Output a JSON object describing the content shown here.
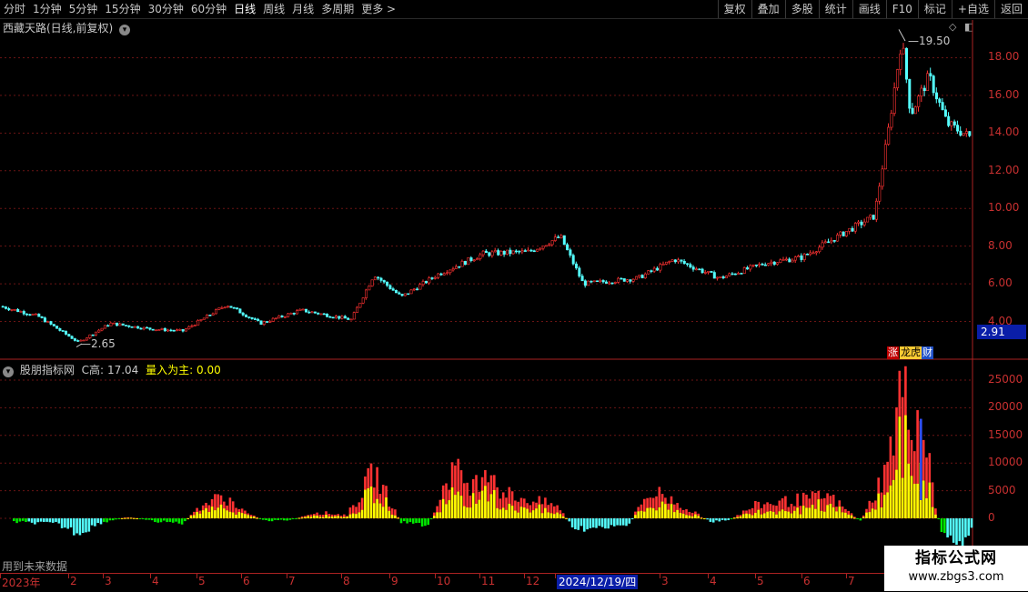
{
  "toolbar": {
    "periods": [
      "分时",
      "1分钟",
      "5分钟",
      "15分钟",
      "30分钟",
      "60分钟",
      "日线",
      "周线",
      "月线",
      "多周期",
      "更多 >"
    ],
    "active_period": "日线",
    "actions": [
      "复权",
      "叠加",
      "多股",
      "统计",
      "画线",
      "F10",
      "标记",
      "+自选",
      "返回"
    ]
  },
  "main_chart": {
    "title": "西藏天路(日线,前复权)",
    "high_label": "19.50",
    "low_label": "2.65",
    "axis_labels": [
      "18.00",
      "16.00",
      "14.00",
      "12.00",
      "10.00",
      "8.00",
      "6.00",
      "4.00"
    ],
    "current_price_tag": "2.91",
    "badges": [
      "涨",
      "龙虎",
      "财"
    ]
  },
  "indicator": {
    "name": "股朋指标网",
    "label1": "C高:",
    "value1": "17.04",
    "label2": "量入为主:",
    "value2": "0.00",
    "axis_labels": [
      "25000",
      "20000",
      "15000",
      "10000",
      "5000",
      "0"
    ],
    "footer_note": "用到未来数据"
  },
  "time_axis": {
    "labels": [
      "2023年",
      "2",
      "3",
      "4",
      "5",
      "6",
      "7",
      "8",
      "9",
      "10",
      "11",
      "12",
      "2024/12/19/四",
      "3",
      "4",
      "5",
      "6",
      "7"
    ]
  },
  "watermark": {
    "line1": "指标公式网",
    "line2": "www.zbgs3.com"
  },
  "colors": {
    "up": "#ff3232",
    "down": "#54ffff",
    "yellow": "#ffff00",
    "green": "#00e800",
    "grid": "#aa2222",
    "accent_blue": "#0a1ea8"
  },
  "chart_data": [
    {
      "type": "candlestick",
      "title": "西藏天路(日线,前复权)",
      "y_range": [
        2.5,
        20
      ],
      "x_range": [
        "2023-01",
        "2024-07"
      ],
      "points_monthly_close": [
        {
          "x": "2023-01",
          "y": 4.6
        },
        {
          "x": "2023-02",
          "y": 3.2
        },
        {
          "x": "2023-03",
          "y": 3.9
        },
        {
          "x": "2023-04",
          "y": 3.6
        },
        {
          "x": "2023-05",
          "y": 4.8
        },
        {
          "x": "2023-06",
          "y": 4.0
        },
        {
          "x": "2023-07",
          "y": 4.6
        },
        {
          "x": "2023-08",
          "y": 6.3
        },
        {
          "x": "2023-09",
          "y": 5.3
        },
        {
          "x": "2023-10",
          "y": 7.0
        },
        {
          "x": "2023-11",
          "y": 7.5
        },
        {
          "x": "2023-12",
          "y": 8.4
        },
        {
          "x": "2024-01",
          "y": 6.0
        },
        {
          "x": "2024-02",
          "y": 6.2
        },
        {
          "x": "2024-03",
          "y": 7.2
        },
        {
          "x": "2024-04",
          "y": 6.6
        },
        {
          "x": "2024-05",
          "y": 7.3
        },
        {
          "x": "2024-06",
          "y": 8.8
        },
        {
          "x": "2024-07",
          "y": 16.0
        }
      ],
      "annotations": [
        "19.50",
        "2.65"
      ],
      "grid": true
    },
    {
      "type": "bar",
      "title": "股朋指标网",
      "y_range": [
        -5000,
        25000
      ],
      "series_colors": [
        "red",
        "yellow",
        "cyan",
        "green",
        "blue"
      ],
      "peak_value": 25000,
      "grid": true
    }
  ]
}
